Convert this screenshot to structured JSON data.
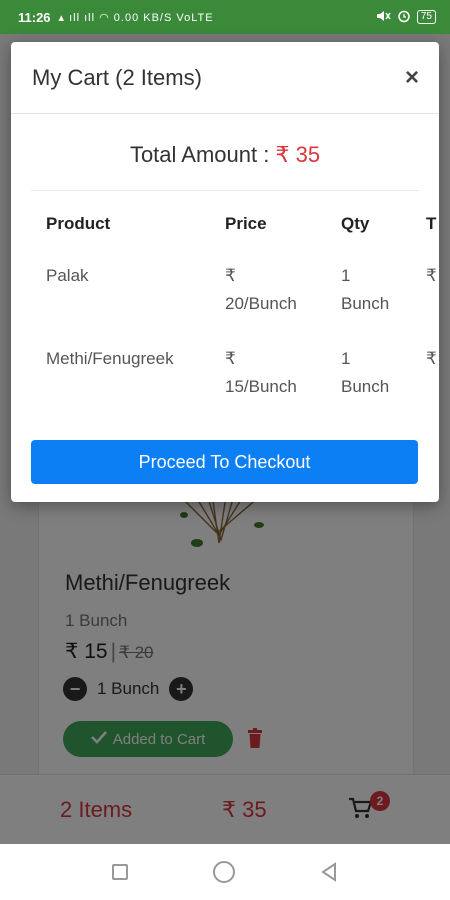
{
  "status_bar": {
    "time": "11:26",
    "indicators": "▴ ıll ıll ◠ 0.00 KB/S VoLTE",
    "battery": "75"
  },
  "product_card": {
    "name": "Methi/Fenugreek",
    "unit": "1 Bunch",
    "price": "₹ 15",
    "separator": "|",
    "old_price": "₹ 20",
    "quantity": "1 Bunch",
    "added_label": "Added to Cart"
  },
  "cart_bar": {
    "items": "2 Items",
    "total": "₹ 35",
    "badge": "2"
  },
  "modal": {
    "title": "My Cart (2 Items)",
    "close": "×",
    "total_label": "Total Amount : ",
    "total_value": "₹ 35",
    "columns": [
      "Product",
      "Price",
      "Qty",
      "T"
    ],
    "rows": [
      {
        "product": "Palak",
        "price_line1": "₹",
        "price_line2": "20/Bunch",
        "qty_line1": "1",
        "qty_line2": "Bunch",
        "total": "₹"
      },
      {
        "product": "Methi/Fenugreek",
        "price_line1": "₹",
        "price_line2": "15/Bunch",
        "qty_line1": "1",
        "qty_line2": "Bunch",
        "total": "₹"
      }
    ],
    "checkout_label": "Proceed To Checkout"
  },
  "colors": {
    "status_green": "#3a8a3a",
    "price_red": "#d9363e",
    "checkout_blue": "#0d7ff5",
    "added_green": "#3fa95a"
  }
}
